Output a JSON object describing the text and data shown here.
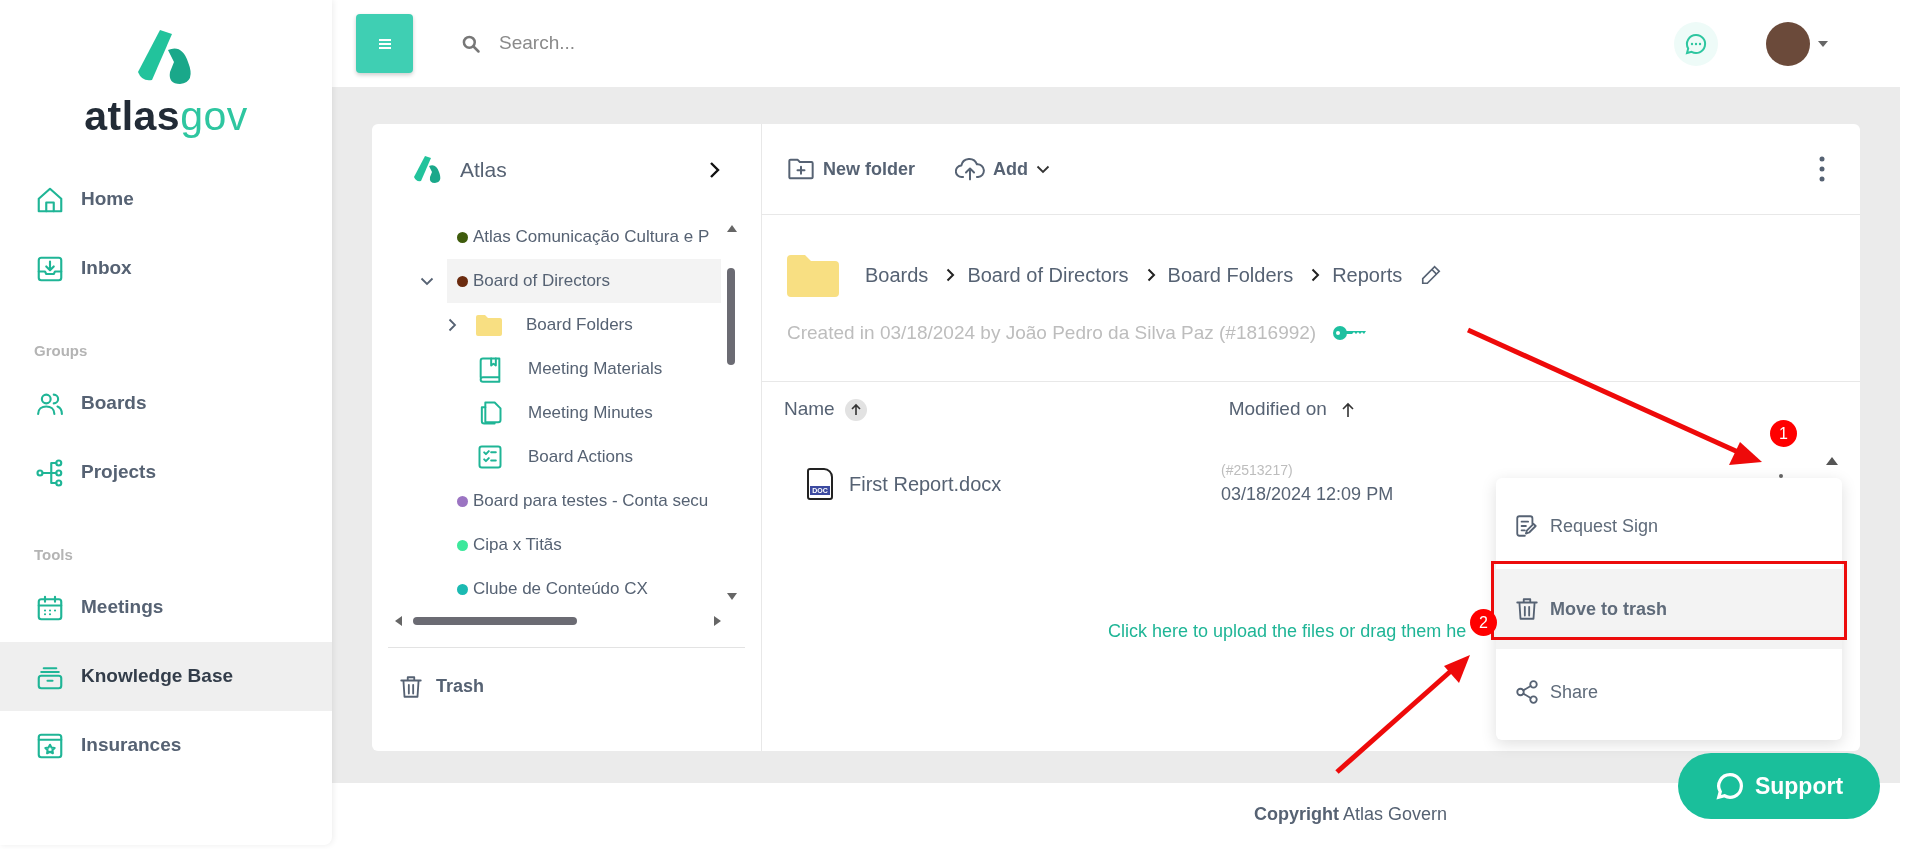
{
  "sidebar": {
    "logo": {
      "brand_dark": "atlas",
      "brand_light": "gov"
    },
    "groups": [
      {
        "items": [
          {
            "label": "Home",
            "kind": "home",
            "selected": false
          },
          {
            "label": "Inbox",
            "kind": "inbox",
            "selected": false
          }
        ]
      },
      {
        "heading": "Groups",
        "items": [
          {
            "label": "Boards",
            "kind": "people",
            "selected": false
          },
          {
            "label": "Projects",
            "kind": "branches",
            "selected": false
          }
        ]
      },
      {
        "heading": "Tools",
        "items": [
          {
            "label": "Meetings",
            "kind": "calendar",
            "selected": false
          },
          {
            "label": "Knowledge Base",
            "kind": "archive",
            "selected": true
          },
          {
            "label": "Insurances",
            "kind": "shield",
            "selected": false
          }
        ]
      }
    ]
  },
  "topbar": {
    "search": {
      "placeholder": "Search..."
    }
  },
  "tree": {
    "title": "Atlas",
    "nodes": [
      {
        "label": "Atlas Comunicação Cultura e P",
        "color": "#3f5c0c",
        "selected": false
      },
      {
        "label": "Board of Directors",
        "color": "#6a2a0e",
        "selected": true,
        "expanded": true,
        "children": [
          {
            "label": "Board Folders",
            "kind": "folder",
            "selected": false,
            "expanded": false
          },
          {
            "label": "Meeting Materials",
            "kind": "book",
            "selected": false
          },
          {
            "label": "Meeting Minutes",
            "kind": "copies",
            "selected": false
          },
          {
            "label": "Board Actions",
            "kind": "checklist",
            "selected": false
          }
        ]
      },
      {
        "label": "Board para testes - Conta secu",
        "color": "#9b74c2",
        "selected": false
      },
      {
        "label": "Cipa x Titãs",
        "color": "#3de89c",
        "selected": false
      },
      {
        "label": "Clube de Conteúdo CX",
        "color": "#1bbab2",
        "selected": false
      }
    ],
    "trash": "Trash"
  },
  "toolbar": {
    "new_folder": "New folder",
    "add": "Add"
  },
  "breadcrumb": [
    "Boards",
    "Board of Directors",
    "Board Folders",
    "Reports"
  ],
  "created": "Created in 03/18/2024 by João Pedro da Silva Paz (#1816992)",
  "table": {
    "columns": [
      "Name",
      "Modified on"
    ],
    "rows": [
      {
        "name": "First Report.docx",
        "file_type": "DOC",
        "id": "(#2513217)",
        "modified": "03/18/2024 12:09 PM"
      }
    ]
  },
  "upload_hint": "Click here to upload the files or drag them he",
  "context_menu": [
    {
      "label": "Request Sign",
      "kind": "sign",
      "selected": false
    },
    {
      "label": "Move to trash",
      "kind": "trash",
      "selected": true
    },
    {
      "label": "Share",
      "kind": "share",
      "selected": false
    }
  ],
  "annotations": {
    "badges": [
      "1",
      "2"
    ]
  },
  "footer": {
    "label": "Copyright",
    "text": "Atlas Govern"
  },
  "support": "Support"
}
